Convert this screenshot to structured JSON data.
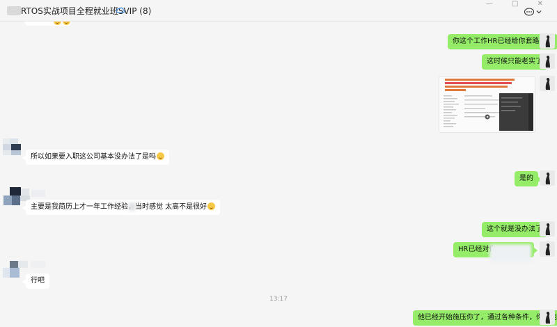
{
  "window": {
    "title": "RTOS实战项目全程就业班SVIP (8)",
    "controls": "— □ ✕"
  },
  "messages": [
    {
      "side": "me",
      "text": "你这个工作HR已经给你套路住了"
    },
    {
      "side": "me",
      "text": "这时候只能老实了"
    },
    {
      "side": "me",
      "type": "image"
    },
    {
      "side": "other",
      "text": "所以如果要入职这公司基本没办法了是吗"
    },
    {
      "side": "me",
      "text": "是的"
    },
    {
      "side": "other",
      "text": "主要是我简历上才一年工作经验，当时感觉   太高不是很好"
    },
    {
      "side": "me",
      "text": "这个就是没办法了"
    },
    {
      "side": "me",
      "text": "HR已经对你"
    },
    {
      "side": "other",
      "text": "行吧"
    },
    {
      "side": "me",
      "text": "他已经开始施压你了，通过各种条件，你看他说的"
    }
  ],
  "timestamp": "13:17",
  "colors": {
    "my_bubble": "#95ec69",
    "other_bubble": "#ffffff",
    "background": "#f5f5f5"
  },
  "icons": {
    "status": "cloud-sync-icon",
    "more": "chat-bubble-more-icon",
    "expand": "chevron-down-icon"
  }
}
